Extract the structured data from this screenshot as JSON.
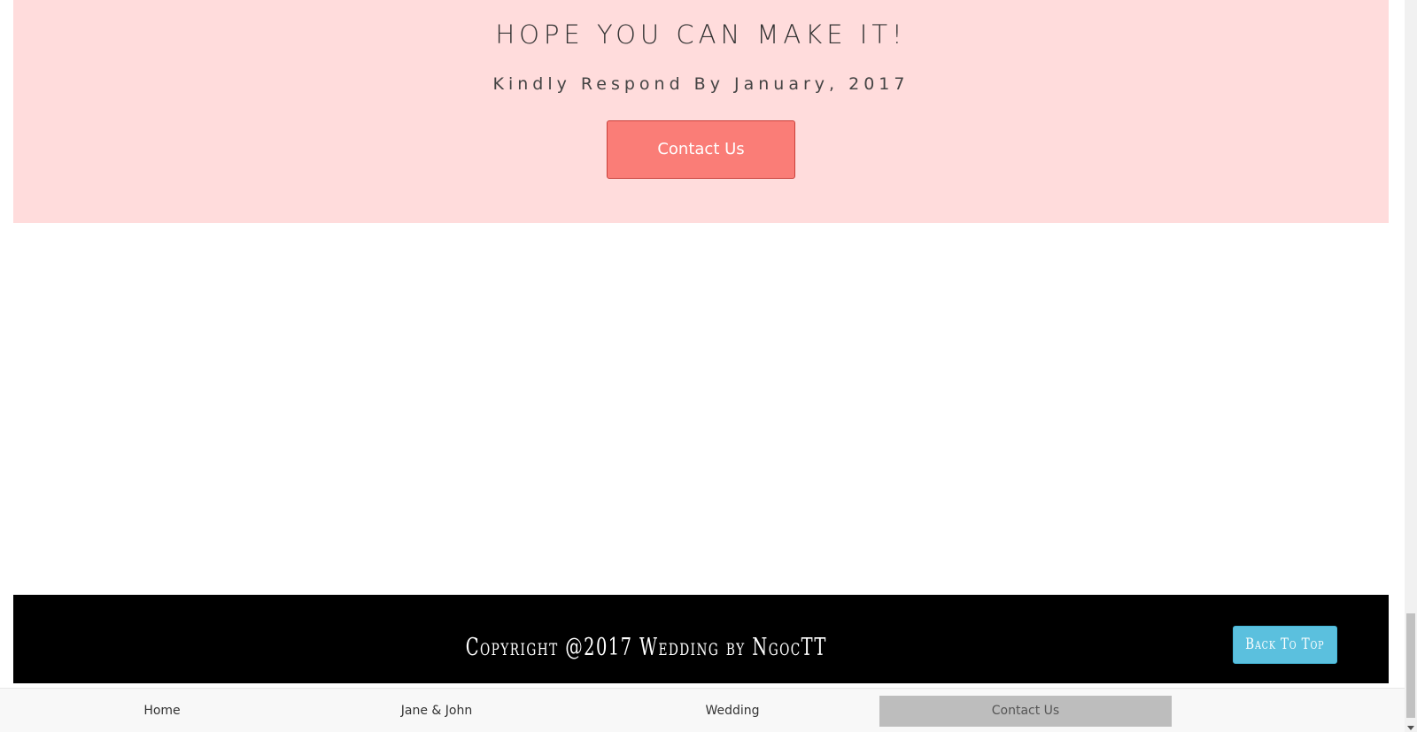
{
  "rsvp": {
    "title": "HOPE YOU CAN MAKE IT!",
    "subtitle": "Kindly Respond By January, 2017",
    "contact_button_label": "Contact Us"
  },
  "footer": {
    "copyright": "Copyright @2017 Wedding by NgocTT",
    "back_to_top_label": "Back To Top"
  },
  "nav": {
    "items": [
      {
        "label": "Home",
        "active": false
      },
      {
        "label": "Jane & John",
        "active": false
      },
      {
        "label": "Wedding",
        "active": false
      },
      {
        "label": "Contact Us",
        "active": true
      }
    ]
  },
  "colors": {
    "rsvp_background": "#ffdcdc",
    "contact_button": "#fa7d77",
    "footer_background": "#000000",
    "back_to_top_button": "#5bc0de",
    "nav_active": "#bdbdbd"
  }
}
